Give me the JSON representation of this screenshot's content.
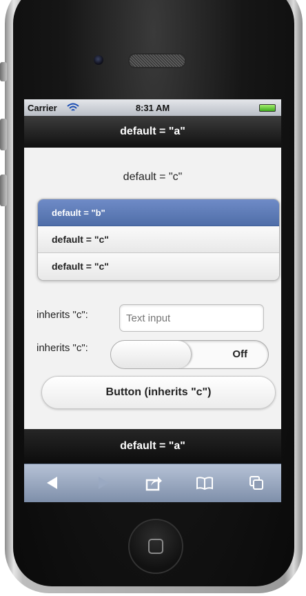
{
  "status_bar": {
    "carrier": "Carrier",
    "time": "8:31 AM"
  },
  "header": {
    "title": "default = \"a\""
  },
  "content": {
    "title": "default = \"c\""
  },
  "listview": {
    "items": [
      {
        "label": "default = \"b\"",
        "theme": "b"
      },
      {
        "label": "default = \"c\"",
        "theme": "c"
      },
      {
        "label": "default = \"c\"",
        "theme": "c"
      }
    ]
  },
  "form": {
    "text_label": "inherits \"c\":",
    "text_placeholder": "Text input",
    "slider_label": "inherits \"c\":",
    "slider_value": "Off"
  },
  "button": {
    "label": "Button (inherits \"c\")"
  },
  "footer": {
    "title": "default = \"a\""
  },
  "toolbar": {
    "icons": [
      "back-icon",
      "forward-icon",
      "share-icon",
      "bookmarks-icon",
      "tabs-icon"
    ]
  },
  "colors": {
    "theme_b": "#5671ab",
    "bar_dark": "#141414",
    "toolbar": "#8d9bb3"
  }
}
